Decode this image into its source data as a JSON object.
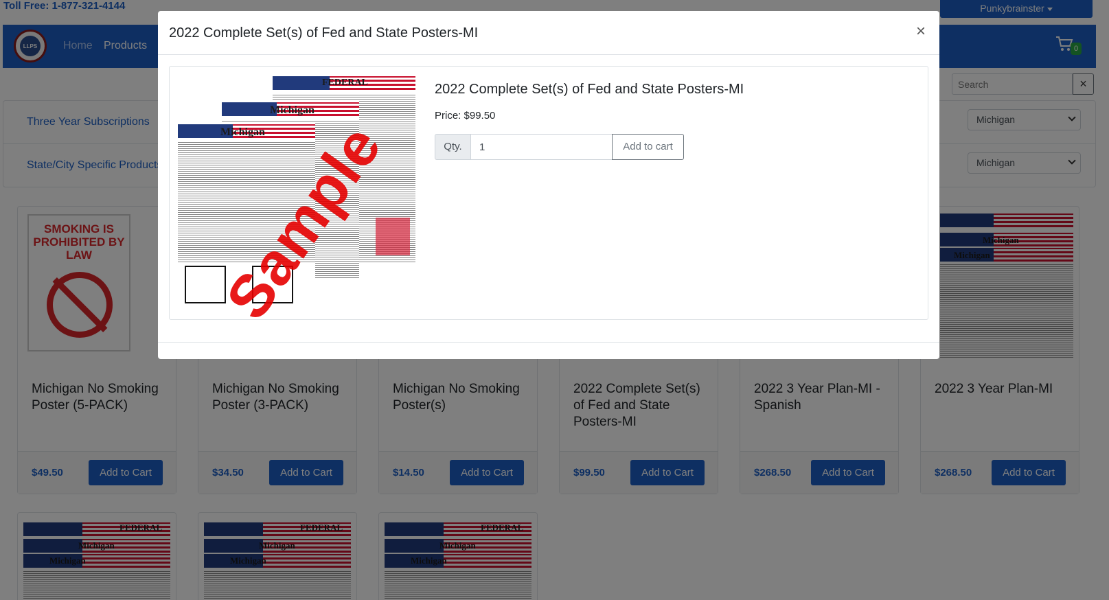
{
  "topbar": {
    "toll_free": "Toll Free: 1-877-321-4144",
    "user": "Punkybrainster"
  },
  "navbar": {
    "logo_text": "LLPS",
    "home": "Home",
    "products": "Products",
    "cart_count": "0"
  },
  "search": {
    "placeholder": "Search",
    "clear": "×"
  },
  "filters": [
    {
      "label": "Three Year Subscriptions",
      "selected": "Michigan"
    },
    {
      "label": "State/City Specific Products",
      "selected": "Michigan"
    }
  ],
  "products": [
    {
      "title": "Michigan No Smoking Poster (5-PACK)",
      "price": "$49.50",
      "button": "Add to Cart"
    },
    {
      "title": "Michigan No Smoking Poster (3-PACK)",
      "price": "$34.50",
      "button": "Add to Cart"
    },
    {
      "title": "Michigan No Smoking Poster(s)",
      "price": "$14.50",
      "button": "Add to Cart"
    },
    {
      "title": "2022 Complete Set(s) of Fed and State Posters-MI",
      "price": "$99.50",
      "button": "Add to Cart"
    },
    {
      "title": "2022 3 Year Plan-MI - Spanish",
      "price": "$268.50",
      "button": "Add to Cart"
    },
    {
      "title": "2022 3 Year Plan-MI",
      "price": "$268.50",
      "button": "Add to Cart"
    }
  ],
  "no_smoking_sign": {
    "heading": "SMOKING IS PROHIBITED BY LAW"
  },
  "poster_words": {
    "federal": "FEDERAL",
    "state": "Michigan"
  },
  "modal": {
    "title": "2022 Complete Set(s) of Fed and State Posters-MI",
    "close": "×",
    "product_title": "2022 Complete Set(s) of Fed and State Posters-MI",
    "price": "Price: $99.50",
    "qty_label": "Qty.",
    "qty_value": "1",
    "add_button": "Add to cart",
    "stamp": "Sample"
  }
}
